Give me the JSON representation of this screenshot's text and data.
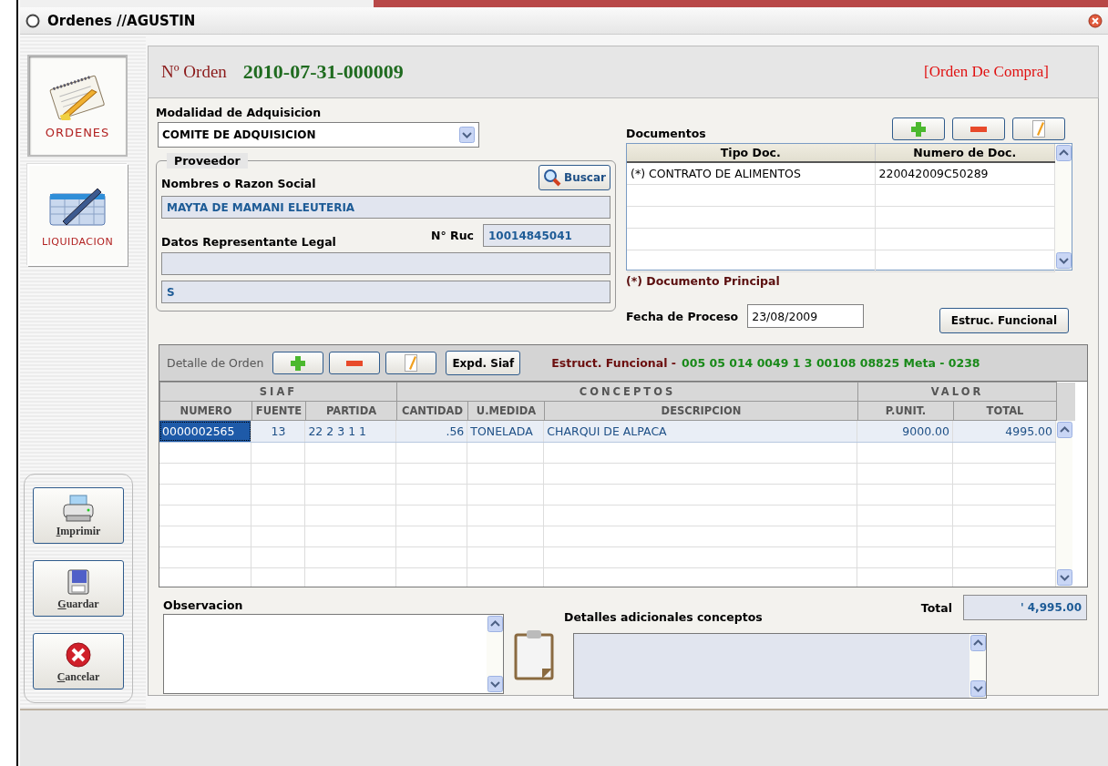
{
  "window": {
    "title": "Ordenes //AGUSTIN"
  },
  "sidebar": {
    "nav": [
      {
        "label": "ORDENES",
        "kind": "orders",
        "selected": true
      },
      {
        "label": "LIQUIDACION",
        "kind": "liquidation",
        "selected": false
      }
    ],
    "actions": [
      {
        "label": "Imprimir",
        "kind": "print"
      },
      {
        "label": "Guardar",
        "kind": "save"
      },
      {
        "label": "Cancelar",
        "kind": "cancel"
      }
    ]
  },
  "header": {
    "order_label": "Nº Orden",
    "order_number": "2010-07-31-000009",
    "order_type": "[Orden De Compra]"
  },
  "form": {
    "modalidad_label": "Modalidad de Adquisicion",
    "modalidad_value": "COMITE DE ADQUISICION",
    "proveedor": {
      "legend": "Proveedor",
      "search_button": "Buscar",
      "name_label": "Nombres o Razon Social",
      "name_value": "MAYTA DE MAMANI ELEUTERIA",
      "rep_label": "Datos Representante Legal",
      "ruc_label": "N° Ruc",
      "ruc_value": "10014845041",
      "rep_value": "S"
    }
  },
  "documents": {
    "label": "Documentos",
    "columns": [
      "Tipo Doc.",
      "Numero de Doc."
    ],
    "rows": [
      [
        "(*) CONTRATO DE ALIMENTOS",
        "220042009C50289"
      ]
    ],
    "note": "(*) Documento Principal",
    "date_label": "Fecha de Proceso",
    "date_value": "23/08/2009",
    "struct_button": "Estruc. Funcional"
  },
  "detail": {
    "label": "Detalle de Orden",
    "siaf_button": "Expd. Siaf",
    "struct_label": "Estruct. Funcional -",
    "struct_value": "005 05 014 0049 1 3 00108 08825 Meta - 0238",
    "groups": [
      {
        "label": "SIAF",
        "columns": [
          "NUMERO",
          "FUENTE",
          "PARTIDA"
        ]
      },
      {
        "label": "CONCEPTOS",
        "columns": [
          "CANTIDAD",
          "U.MEDIDA",
          "DESCRIPCION"
        ]
      },
      {
        "label": "VALOR",
        "columns": [
          "P.UNIT.",
          "TOTAL"
        ]
      }
    ],
    "rows": [
      {
        "cells": [
          "0000002565",
          "13",
          "22 2 3 1 1",
          ".56",
          "TONELADA",
          "CHARQUI DE ALPACA",
          "9000.00",
          "4995.00"
        ],
        "selected": true
      }
    ]
  },
  "bottom": {
    "observacion_label": "Observacion",
    "details_label": "Detalles adicionales conceptos",
    "total_label": "Total",
    "total_value": "' 4,995.00"
  }
}
